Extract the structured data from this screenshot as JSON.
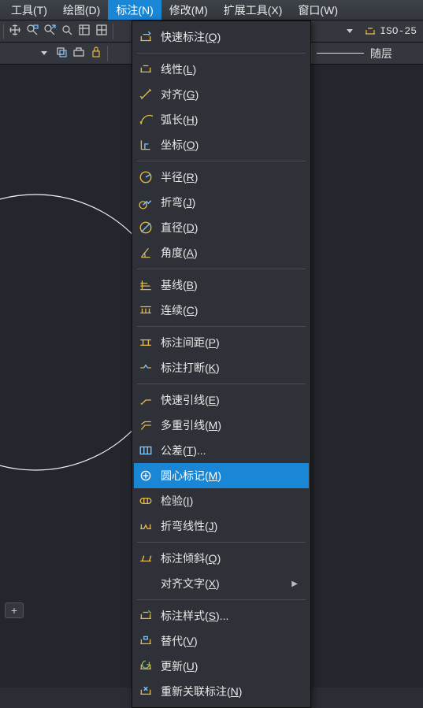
{
  "menubar": [
    {
      "label": "工具(T)",
      "active": false
    },
    {
      "label": "绘图(D)",
      "active": false
    },
    {
      "label": "标注(N)",
      "active": true
    },
    {
      "label": "修改(M)",
      "active": false
    },
    {
      "label": "扩展工具(X)",
      "active": false
    },
    {
      "label": "窗口(W)",
      "active": false
    }
  ],
  "toolbar1": {
    "icons": [
      "pan-icon",
      "zoom-window-icon",
      "zoom-extents-icon",
      "zoom-realtime-icon",
      "properties-icon",
      "grid2-icon"
    ],
    "combo_icon": "dim-style-icon",
    "combo_value": "ISO-25"
  },
  "toolbar2": {
    "left_icons": [
      "layer-copy-icon",
      "layer-walk-icon",
      "layer-lock-icon"
    ],
    "layer_label": "随层"
  },
  "plus_tab": "+",
  "menu": [
    {
      "type": "item",
      "icon": "dim-quick-icon",
      "text": "快速标注",
      "hotkey": "Q"
    },
    {
      "type": "sep"
    },
    {
      "type": "item",
      "icon": "dim-linear-icon",
      "text": "线性",
      "hotkey": "L"
    },
    {
      "type": "item",
      "icon": "dim-aligned-icon",
      "text": "对齐",
      "hotkey": "G"
    },
    {
      "type": "item",
      "icon": "dim-arc-icon",
      "text": "弧长",
      "hotkey": "H"
    },
    {
      "type": "item",
      "icon": "dim-ordinate-icon",
      "text": "坐标",
      "hotkey": "O"
    },
    {
      "type": "sep"
    },
    {
      "type": "item",
      "icon": "dim-radius-icon",
      "text": "半径",
      "hotkey": "R"
    },
    {
      "type": "item",
      "icon": "dim-jog-icon",
      "text": "折弯",
      "hotkey": "J"
    },
    {
      "type": "item",
      "icon": "dim-diameter-icon",
      "text": "直径",
      "hotkey": "D"
    },
    {
      "type": "item",
      "icon": "dim-angular-icon",
      "text": "角度",
      "hotkey": "A"
    },
    {
      "type": "sep"
    },
    {
      "type": "item",
      "icon": "dim-baseline-icon",
      "text": "基线",
      "hotkey": "B"
    },
    {
      "type": "item",
      "icon": "dim-continue-icon",
      "text": "连续",
      "hotkey": "C"
    },
    {
      "type": "sep"
    },
    {
      "type": "item",
      "icon": "dim-space-icon",
      "text": "标注间距",
      "hotkey": "P"
    },
    {
      "type": "item",
      "icon": "dim-break-icon",
      "text": "标注打断",
      "hotkey": "K"
    },
    {
      "type": "sep"
    },
    {
      "type": "item",
      "icon": "q-leader-icon",
      "text": "快速引线",
      "hotkey": "E"
    },
    {
      "type": "item",
      "icon": "m-leader-icon",
      "text": "多重引线",
      "hotkey": "M"
    },
    {
      "type": "item",
      "icon": "tolerance-icon",
      "text": "公差",
      "hotkey": "T",
      "suffix": "..."
    },
    {
      "type": "item",
      "icon": "center-mark-icon",
      "text": "圆心标记",
      "hotkey": "M",
      "highlight": true
    },
    {
      "type": "item",
      "icon": "inspect-icon",
      "text": "检验",
      "hotkey": "I"
    },
    {
      "type": "item",
      "icon": "jog-linear-icon",
      "text": "折弯线性",
      "hotkey": "J"
    },
    {
      "type": "sep"
    },
    {
      "type": "item",
      "icon": "dim-oblique-icon",
      "text": "标注倾斜",
      "hotkey": "Q"
    },
    {
      "type": "item",
      "icon": "",
      "text": "对齐文字",
      "hotkey": "X",
      "submenu": true
    },
    {
      "type": "sep"
    },
    {
      "type": "item",
      "icon": "dim-style-icon",
      "text": "标注样式",
      "hotkey": "S",
      "suffix": "..."
    },
    {
      "type": "item",
      "icon": "dim-override-icon",
      "text": "替代",
      "hotkey": "V"
    },
    {
      "type": "item",
      "icon": "dim-update-icon",
      "text": "更新",
      "hotkey": "U"
    },
    {
      "type": "item",
      "icon": "dim-reassoc-icon",
      "text": "重新关联标注",
      "hotkey": "N"
    }
  ]
}
